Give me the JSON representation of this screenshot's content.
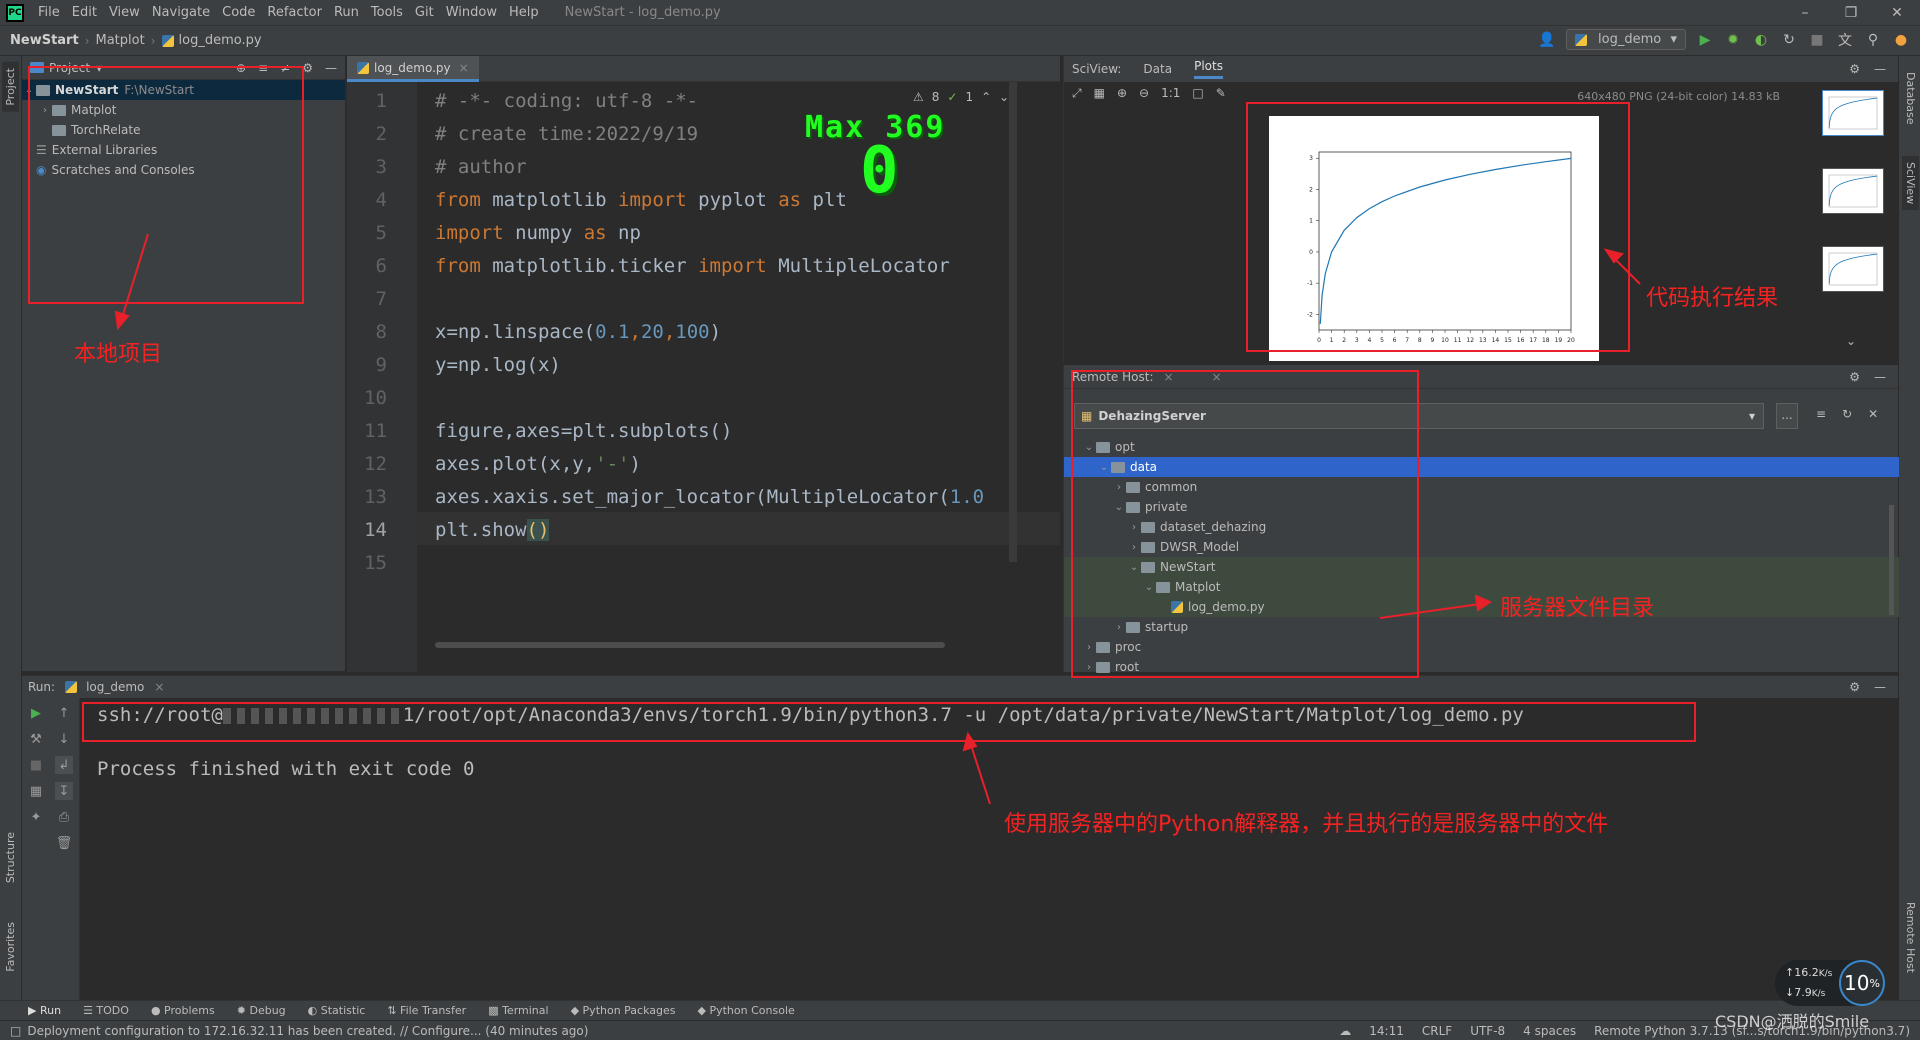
{
  "menu": {
    "logo": "PC",
    "items": [
      "File",
      "Edit",
      "View",
      "Navigate",
      "Code",
      "Refactor",
      "Run",
      "Tools",
      "Git",
      "Window",
      "Help"
    ],
    "window_title": "NewStart - log_demo.py"
  },
  "navbar": {
    "crumbs": [
      "NewStart",
      "Matplot",
      "log_demo.py"
    ],
    "run_config": "log_demo"
  },
  "project": {
    "header": "Project",
    "root_name": "NewStart",
    "root_path": "F:\\NewStart",
    "items": [
      "Matplot",
      "TorchRelate",
      "External Libraries",
      "Scratches and Consoles"
    ]
  },
  "editor": {
    "tab": "log_demo.py",
    "inspection": {
      "warnings": "8",
      "ok": "1"
    },
    "cursor_line": "14",
    "line_numbers": [
      "1",
      "2",
      "3",
      "4",
      "5",
      "6",
      "7",
      "8",
      "9",
      "10",
      "11",
      "12",
      "13",
      "14",
      "15"
    ],
    "lines": {
      "l1": "# -*- coding: utf-8 -*-",
      "l2": "# create time:2022/9/19",
      "l3": "# author",
      "l4_a": "from",
      "l4_b": " matplotlib ",
      "l4_c": "import",
      "l4_d": " pyplot ",
      "l4_e": "as",
      "l4_f": " plt",
      "l5_a": "import",
      "l5_b": " numpy ",
      "l5_c": "as",
      "l5_d": " np",
      "l6_a": "from",
      "l6_b": " matplotlib.ticker ",
      "l6_c": "import",
      "l6_d": " MultipleLocator",
      "l8_a": "x=np.linspace(",
      "l8_b": "0.1",
      "l8_c": ",",
      "l8_d": "20",
      "l8_e": ",",
      "l8_f": "100",
      "l8_g": ")",
      "l9": "y=np.log(x)",
      "l11": "figure,axes=plt.subplots()",
      "l12_a": "axes.plot(x,y,",
      "l12_b": "'-'",
      "l12_c": ")",
      "l13_a": "axes.xaxis.set_major_locator(MultipleLocator(",
      "l13_b": "1.0",
      "l14_a": "plt.show",
      "l14_b": "()"
    }
  },
  "game_overlay": {
    "label": "Max 369",
    "value": "0"
  },
  "sciview": {
    "title": "SciView:",
    "tabs": [
      "Data",
      "Plots"
    ],
    "image_info": "640x480 PNG (24-bit color) 14.83 kB",
    "plot": {
      "yticks": [
        "3",
        "2",
        "1",
        "0",
        "-1",
        "-2"
      ],
      "xticks": [
        "0",
        "1",
        "2",
        "3",
        "4",
        "5",
        "6",
        "7",
        "8",
        "9",
        "10",
        "11",
        "12",
        "13",
        "14",
        "15",
        "16",
        "17",
        "18",
        "19",
        "20"
      ]
    }
  },
  "chart_data": {
    "type": "line",
    "function": "y = ln(x)",
    "x": [
      0.1,
      0.25,
      0.5,
      1,
      2,
      3,
      4,
      5,
      6,
      8,
      10,
      12,
      14,
      16,
      18,
      20
    ],
    "series": [
      {
        "values": [
          -2.303,
          -1.386,
          -0.693,
          0,
          0.693,
          1.099,
          1.386,
          1.609,
          1.792,
          2.079,
          2.303,
          2.485,
          2.639,
          2.773,
          2.89,
          2.996
        ]
      }
    ],
    "xlim": [
      0,
      20
    ],
    "ylim": [
      -2.5,
      3.2
    ],
    "color": "#1f77b4"
  },
  "remote": {
    "title": "Remote Host:",
    "server": "DehazingServer",
    "tree": [
      {
        "label": "opt",
        "type": "folder"
      },
      {
        "label": "data",
        "type": "folder"
      },
      {
        "label": "common",
        "type": "folder"
      },
      {
        "label": "private",
        "type": "folder"
      },
      {
        "label": "dataset_dehazing",
        "type": "folder"
      },
      {
        "label": "DWSR_Model",
        "type": "folder"
      },
      {
        "label": "NewStart",
        "type": "folder"
      },
      {
        "label": "Matplot",
        "type": "folder"
      },
      {
        "label": "log_demo.py",
        "type": "file"
      },
      {
        "label": "startup",
        "type": "folder"
      },
      {
        "label": "proc",
        "type": "folder"
      },
      {
        "label": "root",
        "type": "folder"
      }
    ]
  },
  "run": {
    "label": "Run:",
    "tab": "log_demo",
    "command_prefix": "ssh://root@",
    "command_suffix": "1/root/opt/Anaconda3/envs/torch1.9/bin/python3.7 -u /opt/data/private/NewStart/Matplot/log_demo.py",
    "result": "Process finished with exit code 0"
  },
  "tooltabs": [
    "Run",
    "TODO",
    "Problems",
    "Debug",
    "Statistic",
    "File Transfer",
    "Terminal",
    "Python Packages",
    "Python Console"
  ],
  "side_tabs": {
    "left": [
      "Project",
      "Structure",
      "Favorites"
    ],
    "right": [
      "Database",
      "SciView",
      "Remote Host"
    ]
  },
  "status": {
    "message": "Deployment configuration to 172.16.32.11 has been created. // Configure... (40 minutes ago)",
    "position": "14:11",
    "line_sep": "CRLF",
    "encoding": "UTF-8",
    "indent": "4 spaces",
    "interpreter": "Remote Python 3.7.13 (sf...s/torch1.9/bin/python3.7)"
  },
  "network": {
    "up": "16.2",
    "down": "7.9",
    "unit": "K/s",
    "percent": "10",
    "percent_sign": "%"
  },
  "annotations": {
    "local_project": "本地项目",
    "result": "代码执行结果",
    "server_dir": "服务器文件目录",
    "interpreter": "使用服务器中的Python解释器，并且执行的是服务器中的文件"
  },
  "watermark": "CSDN@洒脱的Smile"
}
